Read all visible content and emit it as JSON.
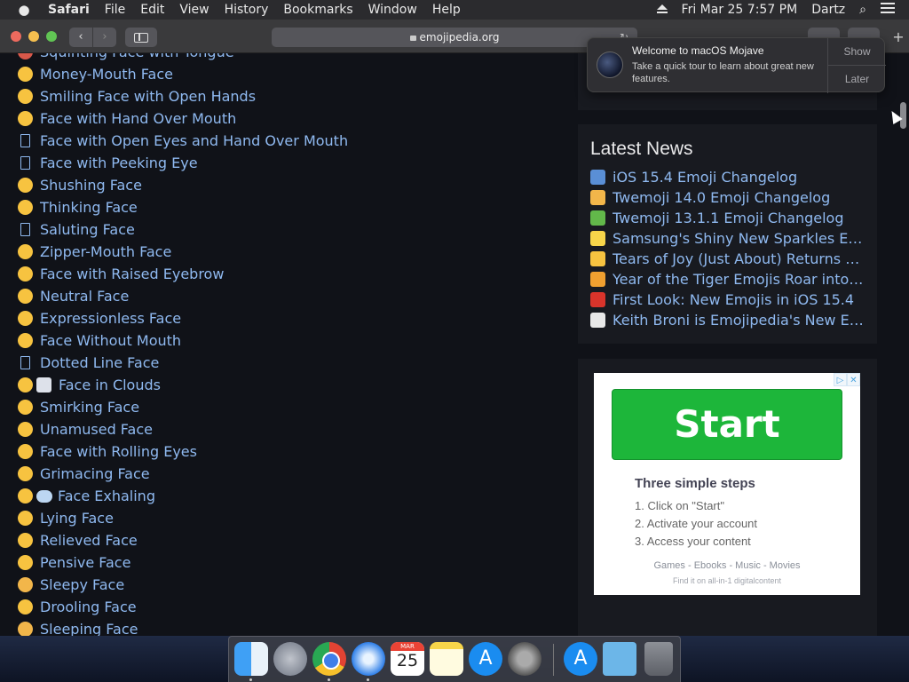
{
  "menubar": {
    "app": "Safari",
    "items": [
      "File",
      "Edit",
      "View",
      "History",
      "Bookmarks",
      "Window",
      "Help"
    ],
    "datetime": "Fri Mar 25  7:57 PM",
    "user": "Dartz"
  },
  "browser": {
    "url": "emojipedia.org"
  },
  "emoji_list": [
    {
      "label": "Squinting Face with Tongue",
      "icon": "squinting-tongue-emoji"
    },
    {
      "label": "Money-Mouth Face",
      "icon": "money-mouth-emoji"
    },
    {
      "label": "Smiling Face with Open Hands",
      "icon": "open-hands-emoji"
    },
    {
      "label": "Face with Hand Over Mouth",
      "icon": "hand-over-mouth-emoji"
    },
    {
      "label": "Face with Open Eyes and Hand Over Mouth",
      "icon": "missing-glyph-box"
    },
    {
      "label": "Face with Peeking Eye",
      "icon": "missing-glyph-box"
    },
    {
      "label": "Shushing Face",
      "icon": "shushing-emoji"
    },
    {
      "label": "Thinking Face",
      "icon": "thinking-emoji"
    },
    {
      "label": "Saluting Face",
      "icon": "missing-glyph-box"
    },
    {
      "label": "Zipper-Mouth Face",
      "icon": "zipper-mouth-emoji"
    },
    {
      "label": "Face with Raised Eyebrow",
      "icon": "raised-eyebrow-emoji"
    },
    {
      "label": "Neutral Face",
      "icon": "neutral-emoji"
    },
    {
      "label": "Expressionless Face",
      "icon": "expressionless-emoji"
    },
    {
      "label": "Face Without Mouth",
      "icon": "no-mouth-emoji"
    },
    {
      "label": "Dotted Line Face",
      "icon": "missing-glyph-box"
    },
    {
      "label": "Face in Clouds",
      "icon": "face-in-clouds-emoji"
    },
    {
      "label": "Smirking Face",
      "icon": "smirking-emoji"
    },
    {
      "label": "Unamused Face",
      "icon": "unamused-emoji"
    },
    {
      "label": "Face with Rolling Eyes",
      "icon": "rolling-eyes-emoji"
    },
    {
      "label": "Grimacing Face",
      "icon": "grimacing-emoji"
    },
    {
      "label": "Face Exhaling",
      "icon": "face-exhaling-emoji"
    },
    {
      "label": "Lying Face",
      "icon": "lying-emoji"
    },
    {
      "label": "Relieved Face",
      "icon": "relieved-emoji"
    },
    {
      "label": "Pensive Face",
      "icon": "pensive-emoji"
    },
    {
      "label": "Sleepy Face",
      "icon": "sleepy-emoji"
    },
    {
      "label": "Drooling Face",
      "icon": "drooling-emoji"
    },
    {
      "label": "Sleeping Face",
      "icon": "sleeping-emoji"
    }
  ],
  "news": {
    "title": "Latest News",
    "items": [
      {
        "label": "iOS 15.4 Emoji Changelog",
        "icon": "phone-emoji",
        "color": "#5a8fd6"
      },
      {
        "label": "Twemoji 14.0 Emoji Changelog",
        "icon": "handshake-emoji",
        "color": "#f2b64a"
      },
      {
        "label": "Twemoji 13.1.1 Emoji Changelog",
        "icon": "battery-emoji",
        "color": "#62b84a"
      },
      {
        "label": "Samsung's Shiny New Sparkles Emoji",
        "icon": "sparkles-emoji",
        "color": "#f7d54a"
      },
      {
        "label": "Tears of Joy (Just About) Returns as Most Used Emoji",
        "icon": "tears-of-joy-emoji",
        "color": "#f7c340"
      },
      {
        "label": "Year of the Tiger Emojis Roar into Life",
        "icon": "tiger-emoji",
        "color": "#f0a030"
      },
      {
        "label": "First Look: New Emojis in iOS 15.4",
        "icon": "apple-emoji",
        "color": "#d9342b"
      },
      {
        "label": "Keith Broni is Emojipedia's New Editor in Chief",
        "icon": "eyes-emoji",
        "color": "#e8e8e8"
      }
    ]
  },
  "ad": {
    "button": "Start",
    "heading": "Three simple steps",
    "steps": [
      "1. Click on \"Start\"",
      "2. Activate your account",
      "3. Access your content"
    ],
    "categories": "Games - Ebooks - Music - Movies",
    "footer": "Find it on all-in-1 digitalcontent",
    "badge_play": "▷",
    "badge_close": "✕"
  },
  "notification": {
    "title": "Welcome to macOS Mojave",
    "body": "Take a quick tour to learn about great new features.",
    "show_label": "Show",
    "later_label": "Later"
  },
  "dock": {
    "calendar_month": "MAR",
    "calendar_day": "25"
  }
}
